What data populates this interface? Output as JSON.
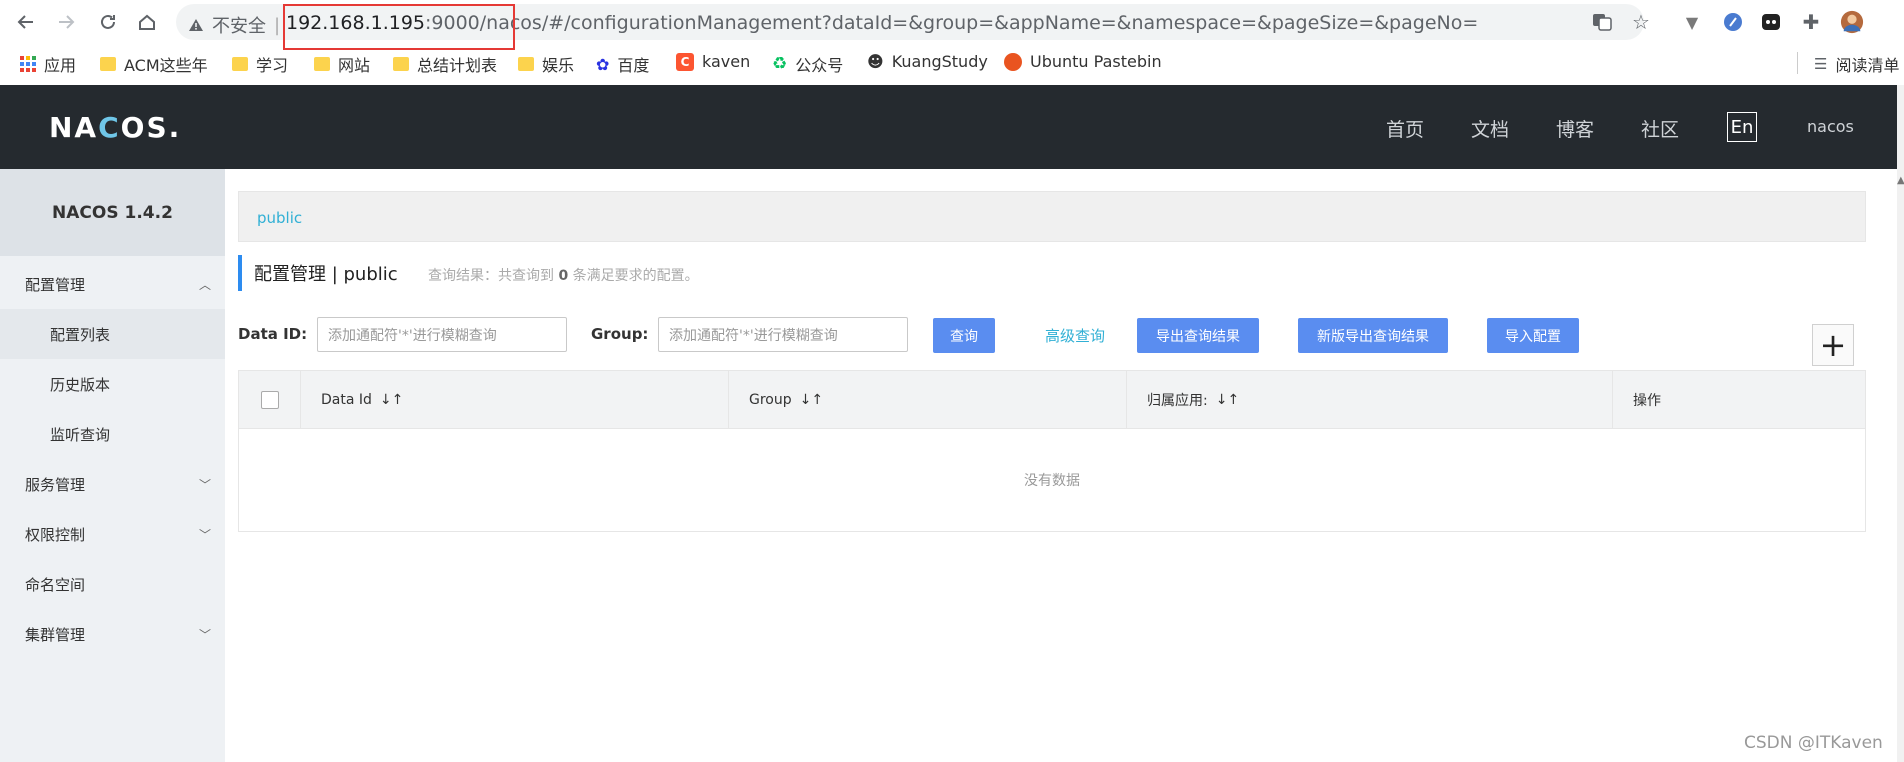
{
  "browser": {
    "insecure_label": "不安全",
    "url_host": "192.168.1.195",
    "url_port_path": ":9000/nacos/",
    "url_rest": "#/configurationManagement?dataId=&group=&appName=&namespace=&pageSize=&pageNo=",
    "bookmarks": [
      "应用",
      "ACM这些年",
      "学习",
      "网站",
      "总结计划表",
      "娱乐",
      "百度",
      "kaven",
      "公众号",
      "KuangStudy",
      "Ubuntu Pastebin"
    ],
    "reading_list": "阅读清单"
  },
  "header": {
    "logo_a": "NA",
    "logo_b": "C",
    "logo_c": "OS.",
    "nav": [
      "首页",
      "文档",
      "博客",
      "社区"
    ],
    "lang": "En",
    "user": "nacos"
  },
  "sidebar": {
    "title": "NACOS 1.4.2",
    "items": [
      "配置管理",
      "配置列表",
      "历史版本",
      "监听查询",
      "服务管理",
      "权限控制",
      "命名空间",
      "集群管理"
    ]
  },
  "main": {
    "breadcrumb": "public",
    "page_title": "配置管理 | public",
    "query_info_prefix": "查询结果：共查询到",
    "query_count": "0",
    "query_info_suffix": "条满足要求的配置。",
    "dataid_label": "Data ID:",
    "dataid_placeholder": "添加通配符'*'进行模糊查询",
    "group_label": "Group:",
    "group_placeholder": "添加通配符'*'进行模糊查询",
    "query_button": "查询",
    "advanced_query": "高级查询",
    "export_button": "导出查询结果",
    "new_export_button": "新版导出查询结果",
    "import_button": "导入配置",
    "plus": "+",
    "columns": [
      "Data Id",
      "Group",
      "归属应用:",
      "操作"
    ],
    "sort_glyph": "↓↑",
    "empty_text": "没有数据"
  },
  "watermark": "CSDN @ITKaven"
}
